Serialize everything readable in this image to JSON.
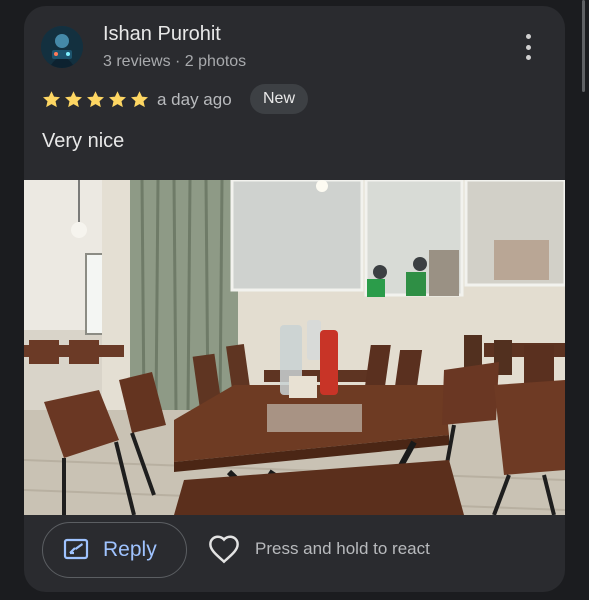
{
  "review": {
    "reviewer_name": "Ishan Purohit",
    "reviewer_meta": "3 reviews · 2 photos",
    "rating": 5,
    "time_ago": "a day ago",
    "badge": "New",
    "text": "Very nice"
  },
  "actions": {
    "reply_label": "Reply",
    "react_label": "Press and hold to react"
  },
  "icons": {
    "more": "more-vert-icon",
    "star": "star-icon",
    "reply": "reply-icon",
    "heart": "heart-outline-icon"
  },
  "colors": {
    "star": "#fdd663",
    "accent": "#9fc3ff",
    "card": "#2a2b2f",
    "background": "#1b1c1f"
  }
}
